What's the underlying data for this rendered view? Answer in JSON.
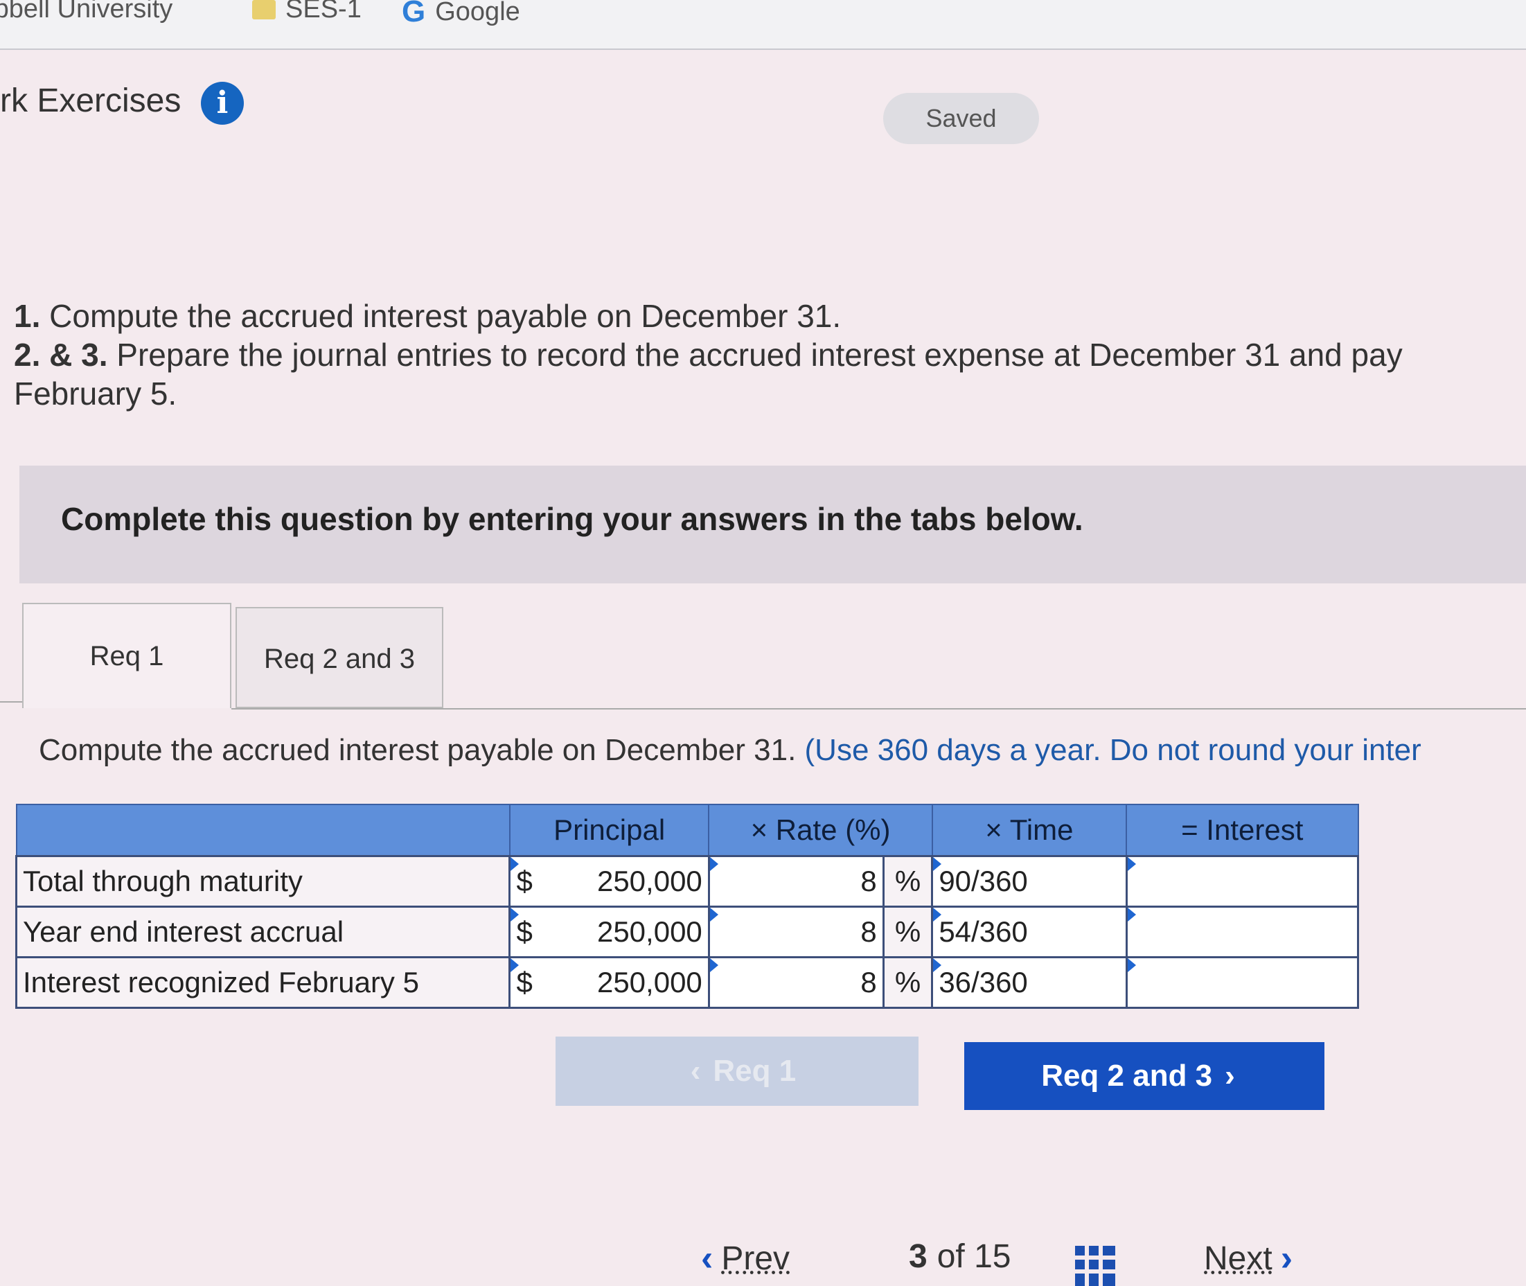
{
  "bookmarks": [
    {
      "label": "mpbell University"
    },
    {
      "label": "SES-1",
      "icon": "folder-icon"
    },
    {
      "label": "Google",
      "icon": "google-icon"
    }
  ],
  "header": {
    "title": "rk Exercises",
    "info_icon": "i",
    "saved": "Saved"
  },
  "instructions": {
    "line1_num": "1.",
    "line1_text": " Compute the accrued interest payable on December 31.",
    "line2_num": "2. & 3.",
    "line2_text": " Prepare the journal entries to record the accrued interest expense at December 31 and pay",
    "line3_text": "February 5."
  },
  "banner": "Complete this question by entering your answers in the tabs below.",
  "tabs": [
    {
      "label": "Req 1",
      "active": true
    },
    {
      "label": "Req 2 and 3",
      "active": false
    }
  ],
  "question": {
    "text": "Compute the accrued interest payable on December 31. ",
    "hint": "(Use 360 days a year. Do not round your inter"
  },
  "table": {
    "headers": [
      "",
      "Principal",
      "× Rate (%)",
      "× Time",
      "= Interest"
    ],
    "rows": [
      {
        "label": "Total through maturity",
        "currency": "$",
        "principal": "250,000",
        "rate": "8",
        "pct": "%",
        "time": "90/360",
        "interest": ""
      },
      {
        "label": "Year end interest accrual",
        "currency": "$",
        "principal": "250,000",
        "rate": "8",
        "pct": "%",
        "time": "54/360",
        "interest": ""
      },
      {
        "label": "Interest recognized February 5",
        "currency": "$",
        "principal": "250,000",
        "rate": "8",
        "pct": "%",
        "time": "36/360",
        "interest": ""
      }
    ]
  },
  "nav_buttons": {
    "prev_label": "Req 1",
    "next_label": "Req 2 and 3",
    "prev_icon": "‹",
    "next_icon": "›"
  },
  "footer": {
    "prev": "Prev",
    "page_current": "3",
    "page_of": "of 15",
    "next": "Next",
    "left_chevron": "‹",
    "right_chevron": "›"
  },
  "colors": {
    "accent": "#1650c0",
    "header_row": "#5e8fda",
    "info_icon": "#1565c0"
  }
}
